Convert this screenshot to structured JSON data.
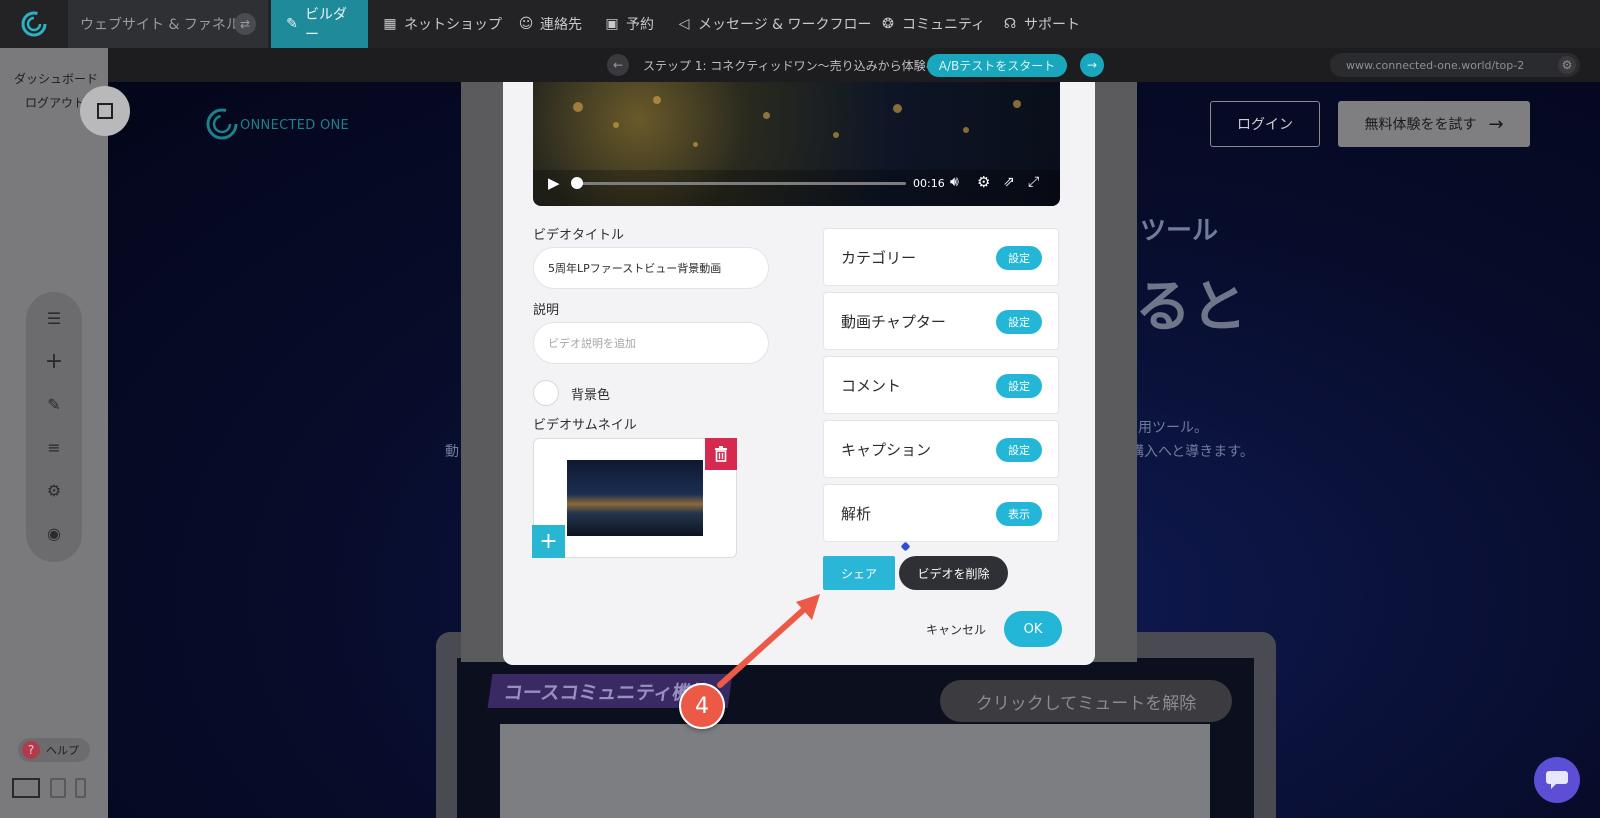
{
  "nav": {
    "site_tab": "ウェブサイト & ファネル",
    "items": [
      {
        "label": "ビルダー",
        "icon": "brush-icon",
        "active": true
      },
      {
        "label": "ネットショップ",
        "icon": "store-icon"
      },
      {
        "label": "連絡先",
        "icon": "contacts-icon"
      },
      {
        "label": "予約",
        "icon": "calendar-icon"
      },
      {
        "label": "メッセージ & ワークフロー",
        "icon": "megaphone-icon"
      },
      {
        "label": "コミュニティ",
        "icon": "community-icon"
      },
      {
        "label": "サポート",
        "icon": "headset-icon"
      }
    ]
  },
  "subbar": {
    "step": "ステップ 1: コネクティッドワン〜売り込みから体験へ〜",
    "ab_test": "A/Bテストをスタート",
    "url": "www.connected-one.world/top-2"
  },
  "sidebar": {
    "dashboard": "ダッシュボード",
    "logout": "ログアウト",
    "help": "ヘルプ"
  },
  "site": {
    "logo_text": "ONNECTED ONE",
    "login": "ログイン",
    "trial": "無料体験をを試す",
    "headline_fragment": "ツール",
    "headline_fragment2": "ると",
    "body_line1": "用ツール。",
    "body_line2": "購入へと導きます。",
    "body_left": "動",
    "course_banner": "コースコミュニティ機能",
    "mute_text": "クリックしてミュートを解除"
  },
  "video": {
    "time": "00:16",
    "progress": 0.0
  },
  "form": {
    "title_label": "ビデオタイトル",
    "title_value": "5周年LPファーストビュー背景動画",
    "desc_label": "説明",
    "desc_placeholder": "ビデオ説明を追加",
    "bg_color_label": "背景色",
    "thumb_label": "ビデオサムネイル"
  },
  "settings": [
    {
      "label": "カテゴリー",
      "button": "設定"
    },
    {
      "label": "動画チャプター",
      "button": "設定"
    },
    {
      "label": "コメント",
      "button": "設定"
    },
    {
      "label": "キャプション",
      "button": "設定"
    },
    {
      "label": "解析",
      "button": "表示"
    }
  ],
  "actions": {
    "share": "シェア",
    "delete": "ビデオを削除",
    "cancel": "キャンセル",
    "ok": "OK"
  },
  "annotation": {
    "step_number": "4"
  },
  "colors": {
    "accent": "#23b6d6",
    "danger": "#d6294f",
    "annotation": "#ec5a47"
  }
}
